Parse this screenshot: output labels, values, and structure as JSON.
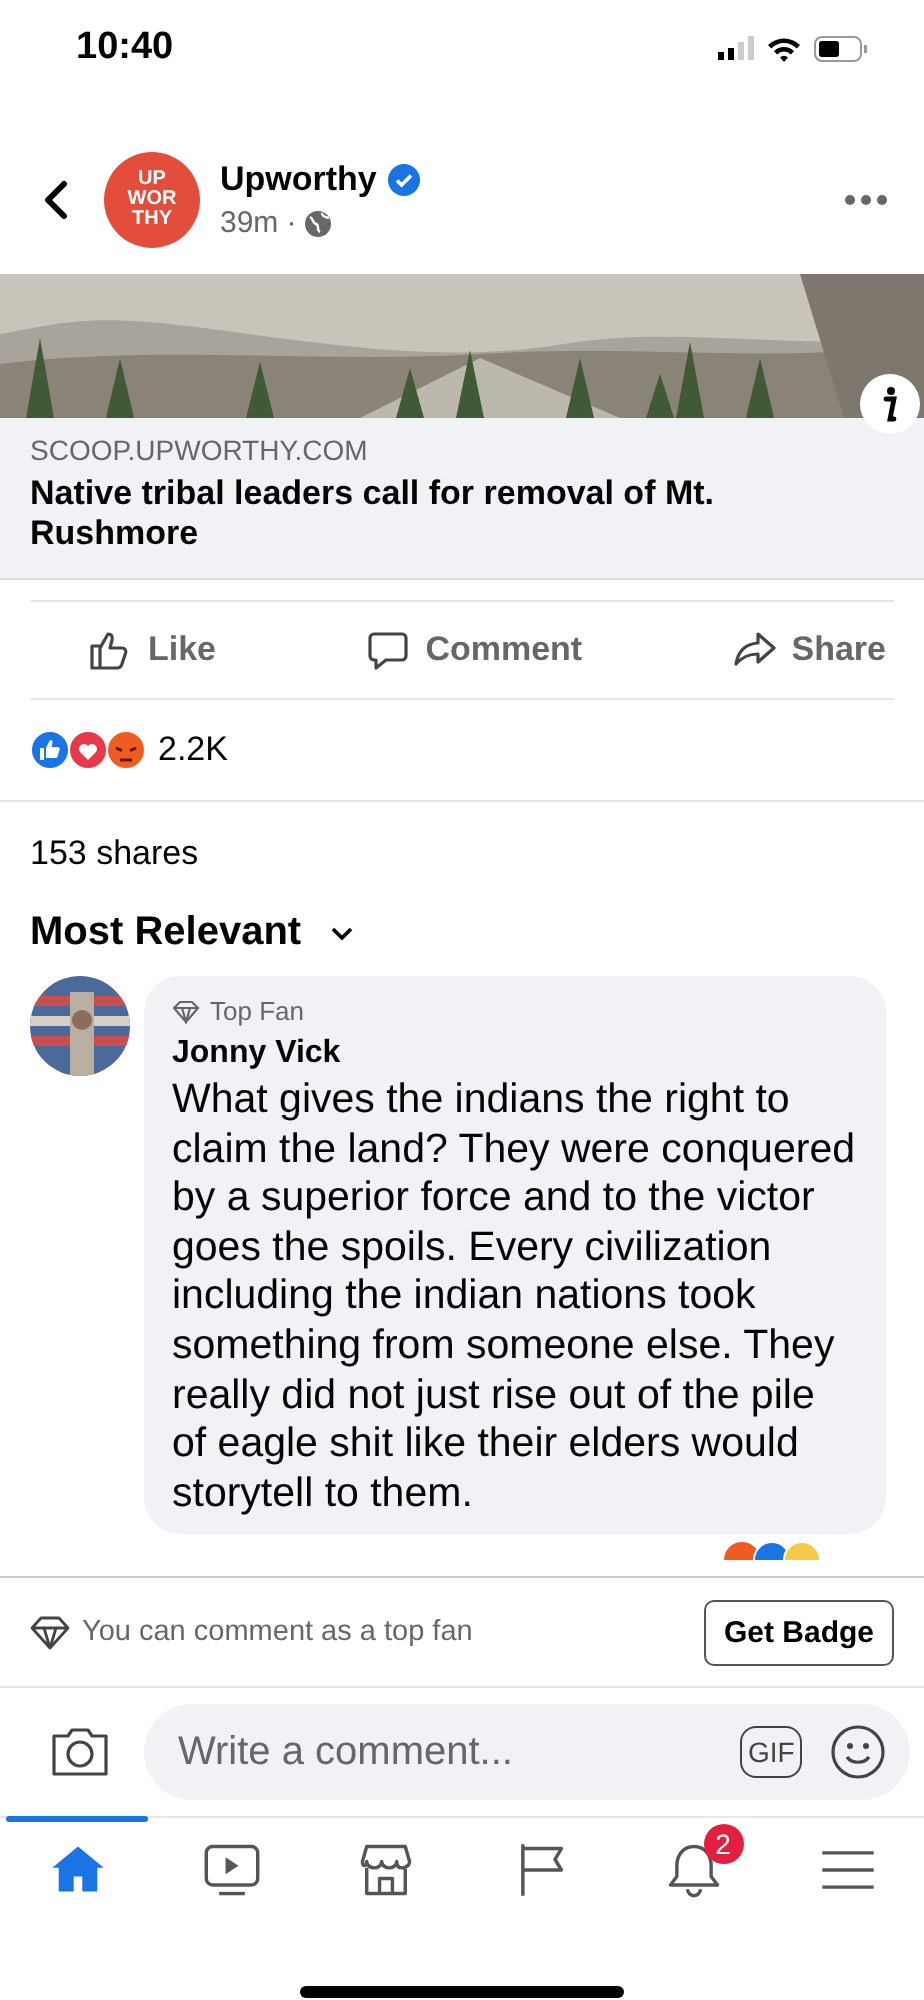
{
  "status_bar": {
    "time": "10:40"
  },
  "post": {
    "page_name": "Upworthy",
    "logo_lines": [
      "UP",
      "WOR",
      "THY"
    ],
    "verified": true,
    "time": "39m",
    "separator": "·"
  },
  "link": {
    "domain": "SCOOP.UPWORTHY.COM",
    "title": "Native tribal leaders call for removal of Mt. Rushmore"
  },
  "actions": [
    {
      "kind": "like",
      "label": "Like"
    },
    {
      "kind": "comment",
      "label": "Comment"
    },
    {
      "kind": "share",
      "label": "Share"
    }
  ],
  "reactions": {
    "count": "2.2K"
  },
  "shares": "153 shares",
  "sort": {
    "label": "Most Relevant"
  },
  "comments": [
    {
      "badge": "Top Fan",
      "author": "Jonny Vick",
      "text": "What gives the indians the right to claim the land? They were conquered by a superior force and to the victor goes the spoils. Every civilization including the indian nations took something from someone else. They really did not just rise out of the pile of eagle shit like their elders would storytell to them."
    }
  ],
  "top_fan_bar": {
    "text": "You can comment as a top fan",
    "button": "Get Badge"
  },
  "composer": {
    "placeholder": "Write a comment...",
    "gif": "GIF"
  },
  "tabs": [
    {
      "kind": "home",
      "selected": true
    },
    {
      "kind": "video",
      "selected": false
    },
    {
      "kind": "marketplace",
      "selected": false
    },
    {
      "kind": "pages",
      "selected": false
    },
    {
      "kind": "notifications",
      "selected": false,
      "badge": "2"
    },
    {
      "kind": "menu",
      "selected": false
    }
  ]
}
